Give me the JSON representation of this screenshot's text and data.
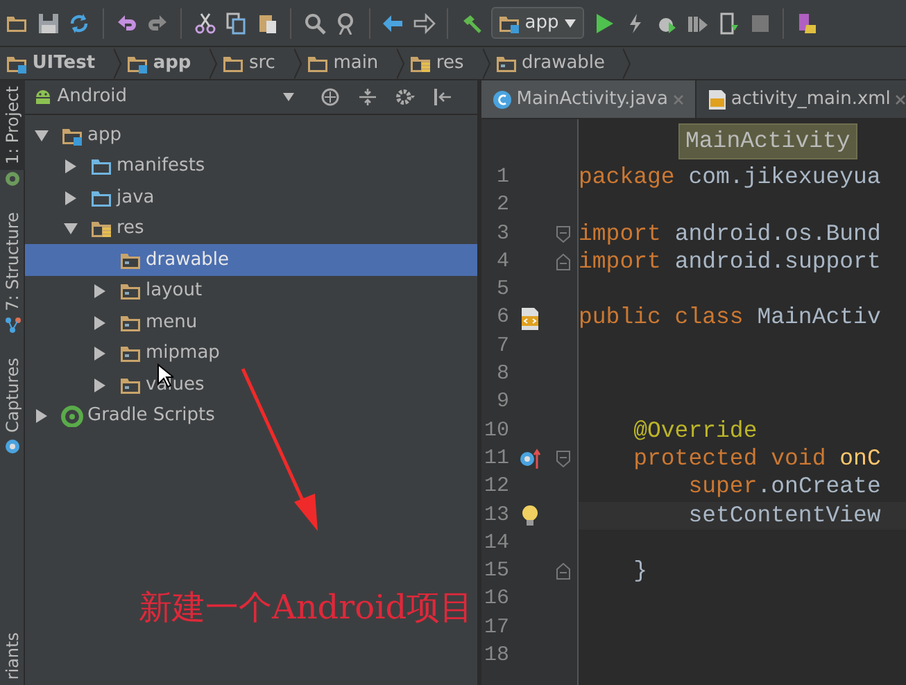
{
  "toolbar": {
    "run_config": "app"
  },
  "breadcrumb": [
    {
      "label": "UITest",
      "kind": "module",
      "bold": true
    },
    {
      "label": "app",
      "kind": "module",
      "bold": true
    },
    {
      "label": "src",
      "kind": "folder",
      "bold": false
    },
    {
      "label": "main",
      "kind": "folder",
      "bold": false
    },
    {
      "label": "res",
      "kind": "res",
      "bold": false
    },
    {
      "label": "drawable",
      "kind": "resdir",
      "bold": false
    }
  ],
  "tool_windows": [
    {
      "label": "1: Project",
      "selected": true
    },
    {
      "label": "7: Structure",
      "selected": false
    },
    {
      "label": "Captures",
      "selected": false
    },
    {
      "label": "riants",
      "selected": false
    }
  ],
  "project_panel": {
    "view": "Android",
    "tree": [
      {
        "label": "app",
        "kind": "module",
        "expanded": true,
        "selected": false,
        "children": [
          {
            "label": "manifests",
            "kind": "source",
            "expanded": false,
            "selected": false
          },
          {
            "label": "java",
            "kind": "source",
            "expanded": false,
            "selected": false
          },
          {
            "label": "res",
            "kind": "res",
            "expanded": true,
            "selected": false,
            "children": [
              {
                "label": "drawable",
                "kind": "resdir",
                "selected": true
              },
              {
                "label": "layout",
                "kind": "resdir",
                "expanded": false,
                "selected": false
              },
              {
                "label": "menu",
                "kind": "resdir",
                "expanded": false,
                "selected": false
              },
              {
                "label": "mipmap",
                "kind": "resdir",
                "expanded": false,
                "selected": false
              },
              {
                "label": "values",
                "kind": "resdir",
                "expanded": false,
                "selected": false
              }
            ]
          }
        ]
      },
      {
        "label": "Gradle Scripts",
        "kind": "gradle",
        "expanded": false,
        "selected": false
      }
    ]
  },
  "editor": {
    "tabs": [
      {
        "label": "MainActivity.java",
        "kind": "java",
        "selected": true
      },
      {
        "label": "activity_main.xml",
        "kind": "xml",
        "selected": false
      }
    ],
    "crumb": "MainActivity",
    "lines": [
      {
        "number": "1",
        "tokens": [
          {
            "text": "package",
            "kind": "keyword"
          },
          {
            "text": " com.jikexueyua",
            "kind": "plain"
          }
        ]
      },
      {
        "number": "2"
      },
      {
        "number": "3",
        "fold_start": true,
        "tokens": [
          {
            "text": "import",
            "kind": "keyword"
          },
          {
            "text": " android.os.Bund",
            "kind": "plain"
          }
        ]
      },
      {
        "number": "4",
        "fold_end": true,
        "tokens": [
          {
            "text": "import",
            "kind": "keyword"
          },
          {
            "text": " android.support",
            "kind": "plain"
          }
        ]
      },
      {
        "number": "5"
      },
      {
        "number": "6",
        "gutter": {
          "kind": "xml"
        },
        "tokens": [
          {
            "text": "public class",
            "kind": "keyword"
          },
          {
            "text": " MainActiv",
            "kind": "plain"
          }
        ]
      },
      {
        "number": "7"
      },
      {
        "number": "8"
      },
      {
        "number": "9"
      },
      {
        "number": "10",
        "tokens": [
          {
            "text": "    @Override",
            "kind": "annotation"
          }
        ]
      },
      {
        "number": "11",
        "gutter": {
          "kind": "override"
        },
        "fold_start": true,
        "tokens": [
          {
            "text": "    protected void",
            "kind": "keyword"
          },
          {
            "text": " onC",
            "kind": "method"
          }
        ]
      },
      {
        "number": "12",
        "tokens": [
          {
            "text": "        super",
            "kind": "keyword"
          },
          {
            "text": ".onCreate",
            "kind": "plain"
          }
        ]
      },
      {
        "number": "13",
        "gutter": {
          "kind": "bulb"
        },
        "current": true,
        "tokens": [
          {
            "text": "        setContentView",
            "kind": "plain"
          }
        ]
      },
      {
        "number": "14"
      },
      {
        "number": "15",
        "fold_end": true,
        "tokens": [
          {
            "text": "    }",
            "kind": "plain"
          }
        ]
      },
      {
        "number": "16"
      },
      {
        "number": "17"
      },
      {
        "number": "18"
      }
    ]
  },
  "annotation": {
    "caption": "新建一个Android项目"
  }
}
